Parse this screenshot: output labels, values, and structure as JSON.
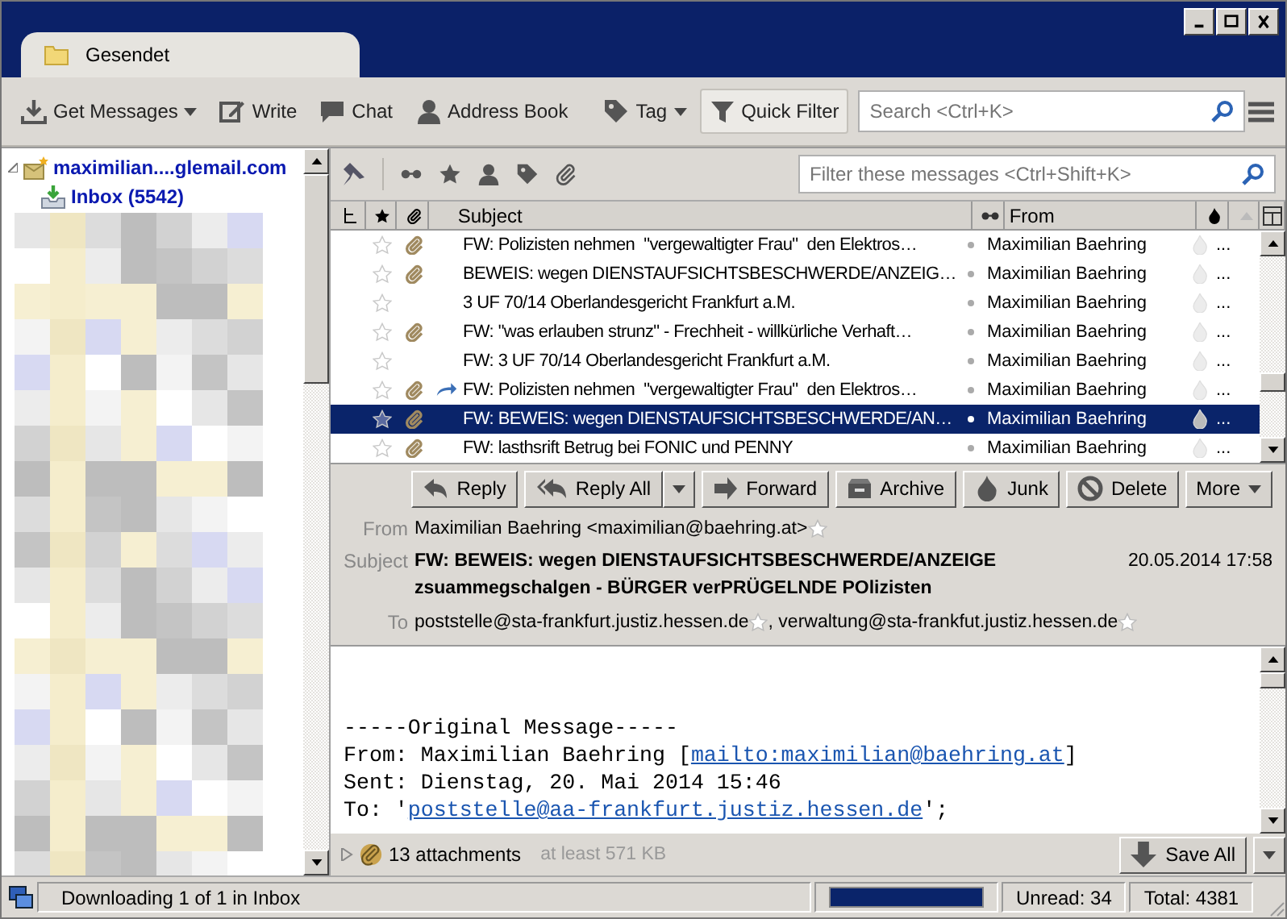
{
  "tab": {
    "title": "Gesendet"
  },
  "toolbar": {
    "items": [
      {
        "kind": "download",
        "label": "Get Messages",
        "menu": true
      },
      {
        "kind": "write",
        "label": "Write",
        "menu": false
      },
      {
        "kind": "chat",
        "label": "Chat",
        "menu": false
      },
      {
        "kind": "contact",
        "label": "Address Book",
        "menu": false
      },
      {
        "kind": "tag",
        "label": "Tag",
        "menu": true
      },
      {
        "kind": "filter",
        "label": "Quick Filter",
        "menu": false
      }
    ],
    "search": {
      "placeholder": "Search <Ctrl+K>"
    }
  },
  "folders": [
    {
      "label": "maximilian....glemail.com",
      "kind": "account",
      "expanded": true,
      "children": [
        {
          "label": "Inbox (5542)",
          "kind": "inbox"
        }
      ]
    }
  ],
  "quick_filter": {
    "placeholder": "Filter these messages <Ctrl+Shift+K>"
  },
  "columns": {
    "subject": "Subject",
    "from": "From"
  },
  "messages": [
    {
      "subject": "FW: Polizisten nehmen  \"vergewaltigter Frau\"  den Elektros…",
      "from": "Maximilian Baehring",
      "attachment": true,
      "forwarded": false,
      "selected": false,
      "extra": "..."
    },
    {
      "subject": "BEWEIS: wegen DIENSTAUFSICHTSBESCHWERDE/ANZEIG…",
      "from": "Maximilian Baehring",
      "attachment": true,
      "forwarded": false,
      "selected": false,
      "extra": "..."
    },
    {
      "subject": "3 UF 70/14 Oberlandesgericht Frankfurt a.M.",
      "from": "Maximilian Baehring",
      "attachment": false,
      "forwarded": false,
      "selected": false,
      "extra": "..."
    },
    {
      "subject": "FW: \"was erlauben strunz\" - Frechheit - willkürliche Verhaft…",
      "from": "Maximilian Baehring",
      "attachment": true,
      "forwarded": false,
      "selected": false,
      "extra": "..."
    },
    {
      "subject": "FW: 3 UF 70/14 Oberlandesgericht Frankfurt a.M.",
      "from": "Maximilian Baehring",
      "attachment": false,
      "forwarded": false,
      "selected": false,
      "extra": "..."
    },
    {
      "subject": "FW: Polizisten nehmen  \"vergewaltigter Frau\"  den Elektros…",
      "from": "Maximilian Baehring",
      "attachment": true,
      "forwarded": true,
      "selected": false,
      "extra": "..."
    },
    {
      "subject": "FW: BEWEIS: wegen DIENSTAUFSICHTSBESCHWERDE/AN…",
      "from": "Maximilian Baehring",
      "attachment": true,
      "forwarded": false,
      "selected": true,
      "extra": "..."
    },
    {
      "subject": "FW: lasthsrift Betrug bei FONIC und PENNY",
      "from": "Maximilian Baehring",
      "attachment": true,
      "forwarded": false,
      "selected": false,
      "extra": "..."
    }
  ],
  "message_actions": [
    {
      "kind": "reply",
      "label": "Reply",
      "menu": false
    },
    {
      "kind": "replyall",
      "label": "Reply All",
      "menu": true
    },
    {
      "kind": "forward",
      "label": "Forward",
      "menu": false
    },
    {
      "kind": "archive",
      "label": "Archive",
      "menu": false
    },
    {
      "kind": "junk",
      "label": "Junk",
      "menu": false
    },
    {
      "kind": "delete",
      "label": "Delete",
      "menu": false
    },
    {
      "kind": "more",
      "label": "More",
      "menu": true
    }
  ],
  "header": {
    "from_label": "From",
    "from": "Maximilian Baehring <maximilian@baehring.at>",
    "subject_label": "Subject",
    "subject_lines": [
      "FW: BEWEIS: wegen DIENSTAUFSICHTSBESCHWERDE/ANZEIGE",
      "zsuammegschalgen - BÜRGER verPRÜGELNDE POlizisten"
    ],
    "date": "20.05.2014 17:58",
    "to_label": "To",
    "to": [
      "poststelle@sta-frankfurt.justiz.hessen.de",
      ", verwaltung@sta-frankfut.justiz.hessen.de"
    ]
  },
  "body": [
    [
      {
        "text": "-----Original Message-----",
        "link": false
      }
    ],
    [
      {
        "text": "From: Maximilian Baehring [",
        "link": false
      },
      {
        "text": "mailto:maximilian@baehring.at",
        "link": true
      },
      {
        "text": "]",
        "link": false
      }
    ],
    [
      {
        "text": "Sent: Dienstag, 20. Mai 2014 15:46",
        "link": false
      }
    ],
    [
      {
        "text": "To: '",
        "link": false
      },
      {
        "text": "poststelle@aa-frankfurt.justiz.hessen.de",
        "link": true
      },
      {
        "text": "';",
        "link": false
      }
    ]
  ],
  "attachments": {
    "count": "13 attachments",
    "size": "at least 571 KB",
    "save": "Save All"
  },
  "status_bar": {
    "text": "Downloading 1 of 1 in Inbox",
    "level": 1,
    "unread": "Unread: 34",
    "total": "Total: 4381"
  }
}
